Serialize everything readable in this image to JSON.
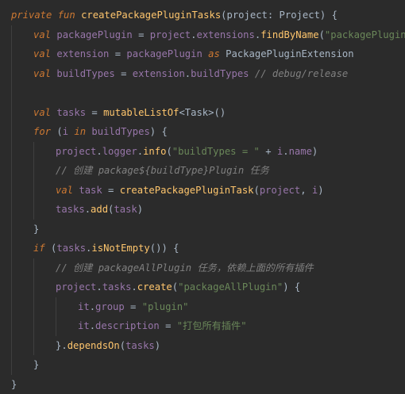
{
  "code_lines": [
    [
      [
        "kw",
        "private fun "
      ],
      [
        "fn",
        "createPackagePluginTasks"
      ],
      [
        "p",
        "(project: Project) {"
      ]
    ],
    [
      [
        "kw",
        "val "
      ],
      [
        "prop",
        "packagePlugin"
      ],
      [
        "p",
        " = "
      ],
      [
        "prop",
        "project"
      ],
      [
        "p",
        "."
      ],
      [
        "prop",
        "extensions"
      ],
      [
        "p",
        "."
      ],
      [
        "fn",
        "findByName"
      ],
      [
        "p",
        "("
      ],
      [
        "str",
        "\"packagePlugin\""
      ],
      [
        "p",
        ")"
      ]
    ],
    [
      [
        "kw",
        "val "
      ],
      [
        "prop",
        "extension"
      ],
      [
        "p",
        " = "
      ],
      [
        "prop",
        "packagePlugin"
      ],
      [
        "kw",
        " as "
      ],
      [
        "p",
        "PackagePluginExtension"
      ]
    ],
    [
      [
        "kw",
        "val "
      ],
      [
        "prop",
        "buildTypes"
      ],
      [
        "p",
        " = "
      ],
      [
        "prop",
        "extension"
      ],
      [
        "p",
        "."
      ],
      [
        "prop",
        "buildTypes"
      ],
      [
        "cmt",
        " // debug/release"
      ]
    ],
    [],
    [
      [
        "kw",
        "val "
      ],
      [
        "prop",
        "tasks"
      ],
      [
        "p",
        " = "
      ],
      [
        "fn",
        "mutableListOf"
      ],
      [
        "p",
        "<Task>()"
      ]
    ],
    [
      [
        "kw",
        "for "
      ],
      [
        "p",
        "("
      ],
      [
        "prop",
        "i"
      ],
      [
        "kw",
        " in "
      ],
      [
        "prop",
        "buildTypes"
      ],
      [
        "p",
        ") {"
      ]
    ],
    [
      [
        "prop",
        "project"
      ],
      [
        "p",
        "."
      ],
      [
        "prop",
        "logger"
      ],
      [
        "p",
        "."
      ],
      [
        "fn",
        "info"
      ],
      [
        "p",
        "("
      ],
      [
        "str",
        "\"buildTypes = \""
      ],
      [
        "p",
        " + "
      ],
      [
        "prop",
        "i"
      ],
      [
        "p",
        "."
      ],
      [
        "prop",
        "name"
      ],
      [
        "p",
        ")"
      ]
    ],
    [
      [
        "cmt",
        "// 创建 package${buildType}Plugin 任务"
      ]
    ],
    [
      [
        "kw",
        "val "
      ],
      [
        "prop",
        "task"
      ],
      [
        "p",
        " = "
      ],
      [
        "fn",
        "createPackagePluginTask"
      ],
      [
        "p",
        "("
      ],
      [
        "prop",
        "project"
      ],
      [
        "p",
        ", "
      ],
      [
        "prop",
        "i"
      ],
      [
        "p",
        ")"
      ]
    ],
    [
      [
        "prop",
        "tasks"
      ],
      [
        "p",
        "."
      ],
      [
        "fn",
        "add"
      ],
      [
        "p",
        "("
      ],
      [
        "prop",
        "task"
      ],
      [
        "p",
        ")"
      ]
    ],
    [
      [
        "p",
        "}"
      ]
    ],
    [
      [
        "kw",
        "if "
      ],
      [
        "p",
        "("
      ],
      [
        "prop",
        "tasks"
      ],
      [
        "p",
        "."
      ],
      [
        "fn",
        "isNotEmpty"
      ],
      [
        "p",
        "()) {"
      ]
    ],
    [
      [
        "cmt",
        "// 创建 packageAllPlugin 任务，依赖上面的所有插件"
      ]
    ],
    [
      [
        "prop",
        "project"
      ],
      [
        "p",
        "."
      ],
      [
        "prop",
        "tasks"
      ],
      [
        "p",
        "."
      ],
      [
        "fn",
        "create"
      ],
      [
        "p",
        "("
      ],
      [
        "str",
        "\"packageAllPlugin\""
      ],
      [
        "p",
        ") {"
      ]
    ],
    [
      [
        "prop",
        "it"
      ],
      [
        "p",
        "."
      ],
      [
        "prop",
        "group"
      ],
      [
        "p",
        " = "
      ],
      [
        "str",
        "\"plugin\""
      ]
    ],
    [
      [
        "prop",
        "it"
      ],
      [
        "p",
        "."
      ],
      [
        "prop",
        "description"
      ],
      [
        "p",
        " = "
      ],
      [
        "str",
        "\"打包所有插件\""
      ]
    ],
    [
      [
        "p",
        "}."
      ],
      [
        "fn",
        "dependsOn"
      ],
      [
        "p",
        "("
      ],
      [
        "prop",
        "tasks"
      ],
      [
        "p",
        ")"
      ]
    ],
    [
      [
        "p",
        "}"
      ]
    ],
    [
      [
        "p",
        "}"
      ]
    ]
  ],
  "colors": {
    "background": "#2b2b2b",
    "keyword": "#cc7832",
    "function": "#ffc66d",
    "property": "#9876aa",
    "string": "#6a8759",
    "comment": "#808080",
    "plain": "#a9b7c6"
  }
}
